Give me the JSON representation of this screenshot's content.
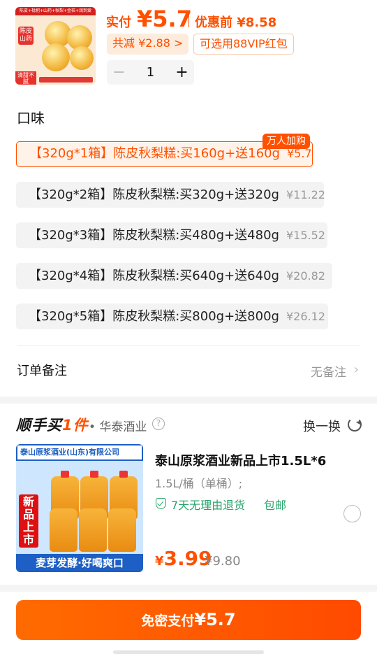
{
  "product": {
    "thumb": {
      "banner": "陈皮+枇杷+山药+秋梨+金桔+润到爱",
      "side_tag": "陈皮山药",
      "bottom_tag": "清甜不腻"
    },
    "paid_label": "实付",
    "paid_value": "¥5.7",
    "orig_price": "优惠前 ¥8.58",
    "discount_chip": "共减 ¥2.88 >",
    "vip_chip": "可选用88VIP红包",
    "quantity": "1",
    "minus": "−",
    "plus": "+"
  },
  "flavor": {
    "title": "口味",
    "hot_badge": "万人加购",
    "options": [
      {
        "label": "【320g*1箱】陈皮秋梨糕:买160g+送160g",
        "price": "¥5.7"
      },
      {
        "label": "【320g*2箱】陈皮秋梨糕:买320g+送320g",
        "price": "¥11.22"
      },
      {
        "label": "【320g*3箱】陈皮秋梨糕:买480g+送480g",
        "price": "¥15.52"
      },
      {
        "label": "【320g*4箱】陈皮秋梨糕:买640g+送640g",
        "price": "¥20.82"
      },
      {
        "label": "【320g*5箱】陈皮秋梨糕:买800g+送800g",
        "price": "¥26.12"
      }
    ]
  },
  "order_note": {
    "label": "订单备注",
    "value": "无备注",
    "chevron": "›"
  },
  "addon": {
    "title_part1": "顺手买",
    "title_part2": "1件",
    "store": "• 华泰酒业",
    "help": "?",
    "swap_label": "换一换",
    "image": {
      "header": "泰山原浆酒业(山东)有限公司",
      "side": "新品上市",
      "footer": "麦芽发酵·好喝爽口"
    },
    "name": "泰山原浆酒业新品上市1.5L*6",
    "spec": "1.5L/桶（单桶）;",
    "return_policy": "7天无理由退货",
    "shipping": "包邮",
    "price_currency": "¥",
    "price_value": "3.99",
    "orig_price": "¥9.80"
  },
  "pay": {
    "label": "免密支付",
    "amount": "¥5.7"
  },
  "colors": {
    "accent": "#ff5000",
    "green": "#2aa36b"
  }
}
